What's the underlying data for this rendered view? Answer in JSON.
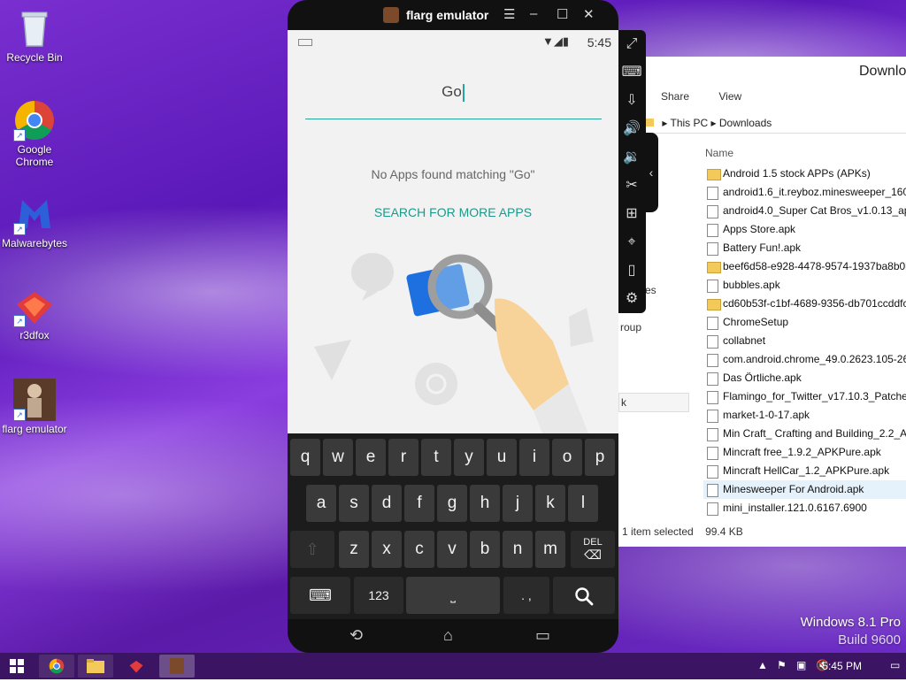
{
  "desktop": {
    "icons": [
      {
        "label": "Recycle Bin"
      },
      {
        "label": "Google Chrome"
      },
      {
        "label": "Malwarebytes"
      },
      {
        "label": "r3dfox"
      },
      {
        "label": "flarg emulator"
      }
    ],
    "windows_version": "Windows 8.1 Pro",
    "build": "Build 9600"
  },
  "emulator": {
    "title": "flarg emulator",
    "time": "5:45",
    "search_text": "Go",
    "no_apps_text": "No Apps found matching \"Go\"",
    "search_more_label": "SEARCH FOR MORE APPS",
    "keyboard": {
      "row1": [
        "q",
        "w",
        "e",
        "r",
        "t",
        "y",
        "u",
        "i",
        "o",
        "p"
      ],
      "row2": [
        "a",
        "s",
        "d",
        "f",
        "g",
        "h",
        "j",
        "k",
        "l"
      ],
      "row3": [
        "z",
        "x",
        "c",
        "v",
        "b",
        "n",
        "m"
      ],
      "del_label": "DEL",
      "num_label": "123",
      "punct_label": ". ,"
    }
  },
  "explorer": {
    "title": "Downloa",
    "menu": [
      "Share",
      "View"
    ],
    "breadcrumb": [
      "This PC",
      "Downloads"
    ],
    "column_name": "Name",
    "left_labels": [
      "es",
      "roup",
      "k"
    ],
    "files": [
      {
        "name": "Android 1.5 stock APPs (APKs)",
        "type": "folder"
      },
      {
        "name": "android1.6_it.reyboz.minesweeper_160.a",
        "type": "file"
      },
      {
        "name": "android4.0_Super Cat Bros_v1.0.13_apkp",
        "type": "file"
      },
      {
        "name": "Apps Store.apk",
        "type": "file"
      },
      {
        "name": "Battery Fun!.apk",
        "type": "file"
      },
      {
        "name": "beef6d58-e928-4478-9574-1937ba8b0b0",
        "type": "folder"
      },
      {
        "name": "bubbles.apk",
        "type": "file"
      },
      {
        "name": "cd60b53f-c1bf-4689-9356-db701ccddfc",
        "type": "folder"
      },
      {
        "name": "ChromeSetup",
        "type": "file"
      },
      {
        "name": "collabnet",
        "type": "file"
      },
      {
        "name": "com.android.chrome_49.0.2623.105-262",
        "type": "file"
      },
      {
        "name": "Das Örtliche.apk",
        "type": "file"
      },
      {
        "name": "Flamingo_for_Twitter_v17.10.3_Patched",
        "type": "file"
      },
      {
        "name": "market-1-0-17.apk",
        "type": "file"
      },
      {
        "name": "Min Craft_ Crafting and Building_2.2_AP",
        "type": "file"
      },
      {
        "name": "Mincraft free_1.9.2_APKPure.apk",
        "type": "file"
      },
      {
        "name": "Mincraft HellCar_1.2_APKPure.apk",
        "type": "file"
      },
      {
        "name": "Minesweeper For Android.apk",
        "type": "file"
      },
      {
        "name": "mini_installer.121.0.6167.6900",
        "type": "file"
      }
    ],
    "status_selected": "1 item selected",
    "status_size": "99.4 KB"
  },
  "taskbar": {
    "clock": "5:45 PM"
  },
  "colors": {
    "accent": "#26a69a",
    "taskbar": "#3b1563"
  }
}
